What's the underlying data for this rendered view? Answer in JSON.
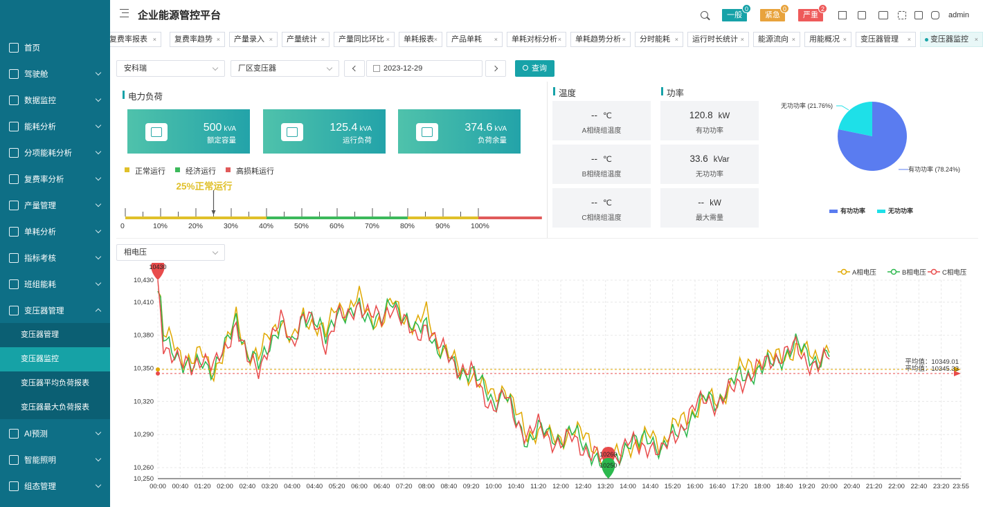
{
  "header": {
    "title": "企业能源管控平台",
    "alarms": [
      {
        "label": "一般",
        "count": "0",
        "color": "#17a2a8",
        "badge": "#17a2a8"
      },
      {
        "label": "紧急",
        "count": "0",
        "color": "#e8a33c",
        "badge": "#e8a33c"
      },
      {
        "label": "严重",
        "count": "2",
        "color": "#ee5a5a",
        "badge": "#ee5a5a"
      }
    ],
    "user": "admin"
  },
  "sidebar": {
    "items": [
      {
        "label": "首页",
        "icon": "home-icon"
      },
      {
        "label": "驾驶舱",
        "icon": "monitor-icon"
      },
      {
        "label": "数据监控",
        "icon": "screen-icon"
      },
      {
        "label": "能耗分析",
        "icon": "bar-chart-icon"
      },
      {
        "label": "分项能耗分析",
        "icon": "line-chart-icon"
      },
      {
        "label": "复费率分析",
        "icon": "bars-icon"
      },
      {
        "label": "产量管理",
        "icon": "clipboard-icon"
      },
      {
        "label": "单耗分析",
        "icon": "trend-icon"
      },
      {
        "label": "指标考核",
        "icon": "chart-icon"
      },
      {
        "label": "班组能耗",
        "icon": "grid-icon"
      },
      {
        "label": "变压器管理",
        "icon": "transformer-icon"
      },
      {
        "label": "AI预测",
        "icon": "users-icon"
      },
      {
        "label": "智能照明",
        "icon": "bulb-icon"
      },
      {
        "label": "组态管理",
        "icon": "layout-icon"
      }
    ],
    "sub_items": [
      "变压器管理",
      "变压器监控",
      "变压器平均负荷报表",
      "变压器最大负荷报表"
    ]
  },
  "tabs": [
    "复费率报表",
    "复费率趋势",
    "产量录入",
    "产量统计",
    "产量同比环比",
    "单耗报表",
    "产品单耗",
    "单耗对标分析",
    "单耗趋势分析",
    "分时能耗",
    "运行时长统计",
    "能源流向",
    "用能概况",
    "变压器管理",
    "变压器监控"
  ],
  "filters": {
    "company": "安科瑞",
    "transformer": "厂区变压器",
    "date": "2023-12-29",
    "query_label": "查询"
  },
  "load": {
    "title": "电力负荷",
    "cards": [
      {
        "value": "500",
        "unit": "kVA",
        "label": "额定容量"
      },
      {
        "value": "125.4",
        "unit": "kVA",
        "label": "运行负荷"
      },
      {
        "value": "374.6",
        "unit": "kVA",
        "label": "负荷余量"
      }
    ],
    "legend": [
      {
        "label": "正常运行",
        "color": "#e0c02a"
      },
      {
        "label": "经济运行",
        "color": "#3cb95b"
      },
      {
        "label": "高损耗运行",
        "color": "#e05a5a"
      }
    ],
    "indicator_text": "25%正常运行",
    "load_rate": 25,
    "scale_labels": [
      "0",
      "10%",
      "20%",
      "30%",
      "40%",
      "50%",
      "60%",
      "70%",
      "80%",
      "90%",
      "100%"
    ]
  },
  "temperature": {
    "title": "温度",
    "tiles": [
      {
        "value": "--",
        "unit": "℃",
        "label": "A相绕组温度"
      },
      {
        "value": "--",
        "unit": "℃",
        "label": "B相绕组温度"
      },
      {
        "value": "--",
        "unit": "℃",
        "label": "C相绕组温度"
      }
    ]
  },
  "power": {
    "title": "功率",
    "tiles": [
      {
        "value": "120.8",
        "unit": "kW",
        "label": "有功功率"
      },
      {
        "value": "33.6",
        "unit": "kVar",
        "label": "无功功率"
      },
      {
        "value": "--",
        "unit": "kW",
        "label": "最大需量"
      }
    ]
  },
  "pie": {
    "label_active": "有功功率 (78.24%)",
    "label_reactive": "无功功率 (21.76%)",
    "legend_active": "有功功率",
    "legend_reactive": "无功功率",
    "color_active": "#5a7cf0",
    "color_reactive": "#1ee0e8"
  },
  "voltage_select": "相电压",
  "chart_data": [
    {
      "type": "pie",
      "slices": [
        {
          "name": "有功功率",
          "value": 78.24
        },
        {
          "name": "无功功率",
          "value": 21.76
        }
      ]
    },
    {
      "type": "line",
      "title": "",
      "x_ticks": [
        "00:00",
        "00:40",
        "01:20",
        "02:00",
        "02:40",
        "03:20",
        "04:00",
        "04:40",
        "05:20",
        "06:00",
        "06:40",
        "07:20",
        "08:00",
        "08:40",
        "09:20",
        "10:00",
        "10:40",
        "11:20",
        "12:00",
        "12:40",
        "13:20",
        "14:00",
        "14:40",
        "15:20",
        "16:00",
        "16:40",
        "17:20",
        "18:00",
        "18:40",
        "19:20",
        "20:00",
        "20:40",
        "21:20",
        "22:00",
        "22:40",
        "23:20",
        "23:55"
      ],
      "y_ticks": [
        "10,250",
        "10,260",
        "10,290",
        "10,320",
        "10,350",
        "10,380",
        "10,410",
        "10,430"
      ],
      "ylim": [
        10250,
        10430
      ],
      "y_tick_values": [
        10250,
        10260,
        10290,
        10320,
        10350,
        10380,
        10410,
        10430
      ],
      "x_range_minutes": [
        0,
        1435
      ],
      "series": [
        {
          "name": "A相电压",
          "color": "#e0a800"
        },
        {
          "name": "B相电压",
          "color": "#2bb84d"
        },
        {
          "name": "C相电压",
          "color": "#e84b4b"
        }
      ],
      "keypoints": [
        [
          0,
          10430
        ],
        [
          10,
          10375
        ],
        [
          30,
          10368
        ],
        [
          45,
          10355
        ],
        [
          60,
          10350
        ],
        [
          80,
          10362
        ],
        [
          100,
          10348
        ],
        [
          120,
          10365
        ],
        [
          140,
          10395
        ],
        [
          160,
          10360
        ],
        [
          180,
          10352
        ],
        [
          200,
          10378
        ],
        [
          220,
          10392
        ],
        [
          240,
          10370
        ],
        [
          260,
          10400
        ],
        [
          280,
          10388
        ],
        [
          300,
          10375
        ],
        [
          320,
          10405
        ],
        [
          340,
          10395
        ],
        [
          360,
          10410
        ],
        [
          380,
          10398
        ],
        [
          400,
          10390
        ],
        [
          420,
          10410
        ],
        [
          440,
          10395
        ],
        [
          460,
          10380
        ],
        [
          480,
          10395
        ],
        [
          500,
          10370
        ],
        [
          520,
          10360
        ],
        [
          540,
          10348
        ],
        [
          560,
          10345
        ],
        [
          580,
          10330
        ],
        [
          600,
          10320
        ],
        [
          620,
          10328
        ],
        [
          640,
          10305
        ],
        [
          660,
          10288
        ],
        [
          680,
          10295
        ],
        [
          700,
          10286
        ],
        [
          720,
          10284
        ],
        [
          740,
          10290
        ],
        [
          760,
          10282
        ],
        [
          780,
          10275
        ],
        [
          800,
          10262
        ],
        [
          820,
          10270
        ],
        [
          840,
          10282
        ],
        [
          860,
          10278
        ],
        [
          880,
          10286
        ],
        [
          900,
          10276
        ],
        [
          920,
          10290
        ],
        [
          940,
          10300
        ],
        [
          960,
          10312
        ],
        [
          980,
          10322
        ],
        [
          1000,
          10318
        ],
        [
          1020,
          10330
        ],
        [
          1040,
          10342
        ],
        [
          1060,
          10348
        ],
        [
          1080,
          10352
        ],
        [
          1100,
          10358
        ],
        [
          1120,
          10362
        ],
        [
          1140,
          10368
        ],
        [
          1160,
          10360
        ],
        [
          1180,
          10356
        ],
        [
          1200,
          10364
        ]
      ],
      "end_minute": 1200,
      "markers": [
        {
          "label": "10430",
          "color": "#e84b4b",
          "x": 0,
          "y": 10430
        },
        {
          "label": "10260",
          "color": "#e84b4b",
          "x": 805,
          "y": 10260
        },
        {
          "label": "10250",
          "color": "#2bb84d",
          "x": 805,
          "y": 10250
        }
      ],
      "avg_lines": [
        {
          "label": "平均值：10349.01",
          "value": 10349.01,
          "color": "#e0a800"
        },
        {
          "label": "平均值：10345.33",
          "value": 10345.33,
          "color": "#e84b4b"
        }
      ]
    }
  ]
}
